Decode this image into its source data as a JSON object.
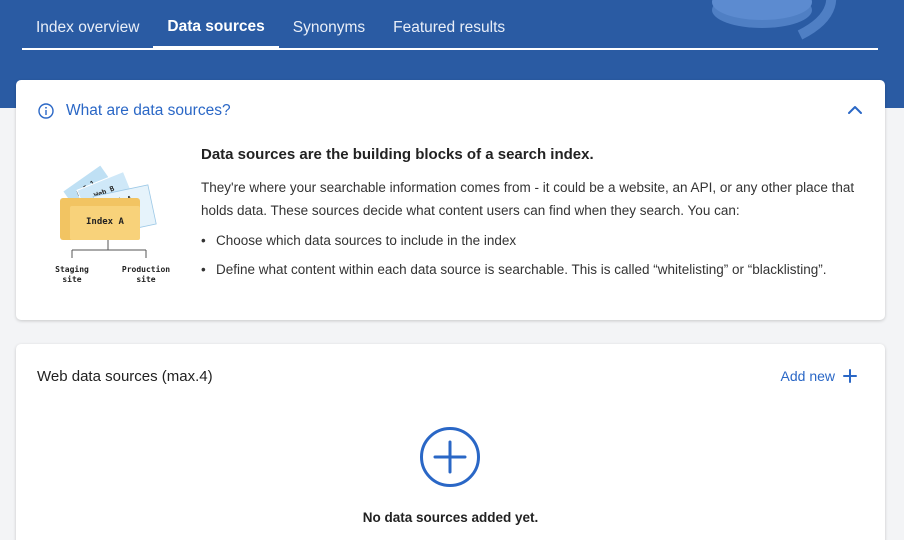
{
  "tabs": [
    {
      "label": "Index overview"
    },
    {
      "label": "Data sources"
    },
    {
      "label": "Synonyms"
    },
    {
      "label": "Featured results"
    }
  ],
  "info": {
    "title": "What are data sources?",
    "heading": "Data sources are the building blocks of a search index.",
    "description": "They're where your searchable information comes from - it could be a website, an API, or any other place that holds data. These sources decide what content users can find when they search. You can:",
    "bullets": [
      "Choose which data sources to include in the index",
      "Define what content within each data source is searchable. This is called “whitelisting” or “blacklisting”."
    ],
    "illustration": {
      "cards": [
        "API 1",
        "Web B",
        "Web A"
      ],
      "folder_label": "Index A",
      "staging_label": [
        "Staging",
        "site"
      ],
      "production_label": [
        "Production",
        "site"
      ]
    }
  },
  "web_sources": {
    "title": "Web data sources (max.4)",
    "add_label": "Add new",
    "empty_text": "No data sources added yet."
  },
  "colors": {
    "header": "#2a5ba3",
    "accent": "#2a67c6",
    "folder": "#f2c462"
  },
  "icons": {
    "info": "info-icon",
    "collapse": "chevron-up-icon",
    "add": "plus-icon",
    "add_circle": "plus-circle-icon"
  }
}
